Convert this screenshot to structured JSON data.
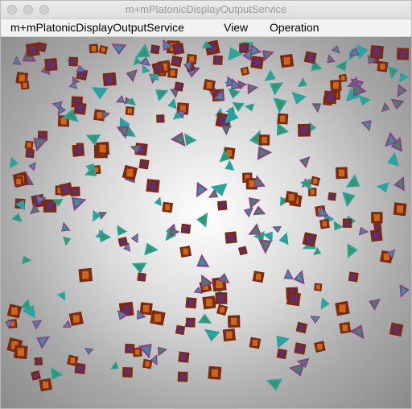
{
  "window": {
    "title": "m+mPlatonicDisplayOutputService"
  },
  "menubar": {
    "items": [
      {
        "label": "m+mPlatonicDisplayOutputService"
      },
      {
        "label": "View"
      },
      {
        "label": "Operation"
      }
    ]
  },
  "scene": {
    "object_types": [
      "cube",
      "tetrahedron"
    ],
    "colors": {
      "cube_dark": "#7a2a12",
      "cube_orange": "#d9731a",
      "cube_purple": "#5a2f8a",
      "tetra_teal": "#2aa3a0",
      "tetra_magenta": "#8a3d8a",
      "tetra_green": "#3f8f5a",
      "background_center": "#ffffff",
      "background_edge": "#8a8a8a"
    }
  }
}
